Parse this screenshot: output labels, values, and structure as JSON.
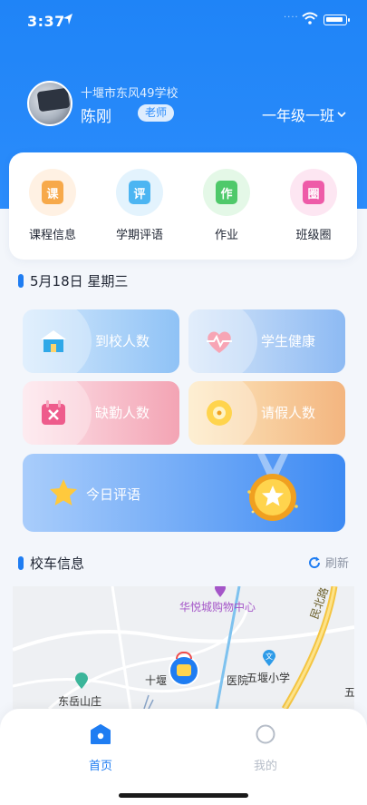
{
  "status_bar": {
    "time": "3:37"
  },
  "profile": {
    "school": "十堰市东风49学校",
    "name": "陈刚",
    "role_badge": "老师",
    "class_selector": "一年级一班"
  },
  "menu": [
    {
      "label": "课程信息",
      "glyph": "课",
      "icon": "course-info-icon",
      "bg": "#fff1e3",
      "fg": "#f7a94a"
    },
    {
      "label": "学期评语",
      "glyph": "评",
      "icon": "term-comment-icon",
      "bg": "#e3f3fd",
      "fg": "#4cb5f2"
    },
    {
      "label": "作业",
      "glyph": "作",
      "icon": "homework-icon",
      "bg": "#e4f8e7",
      "fg": "#4fc96a"
    },
    {
      "label": "班级圈",
      "glyph": "圈",
      "icon": "class-circle-icon",
      "bg": "#fde6f2",
      "fg": "#ee5ba8"
    }
  ],
  "date_section": {
    "title": "5月18日  星期三"
  },
  "stats": [
    {
      "label": "到校人数",
      "icon": "school-arrival-icon",
      "from": "#bfe0fb",
      "to": "#8ec1f6"
    },
    {
      "label": "学生健康",
      "icon": "heart-health-icon",
      "from": "#c7def7",
      "to": "#8dbaf3"
    },
    {
      "label": "缺勤人数",
      "icon": "absence-calendar-icon",
      "from": "#fbdde6",
      "to": "#f3a4b4"
    },
    {
      "label": "请假人数",
      "icon": "leave-clock-icon",
      "from": "#fbe2b6",
      "to": "#f3b57f"
    }
  ],
  "evaluation": {
    "label": "今日评语",
    "star_icon": "star-icon",
    "medal_icon": "medal-icon"
  },
  "bus_section": {
    "title": "校车信息",
    "refresh_label": "刷新"
  },
  "map": {
    "labels": {
      "mall": "华悦城购物中心",
      "hospital": "十堰",
      "hospital_tail": "医院",
      "school": "五堰小学",
      "area": "东岳山庄",
      "road": "民北路",
      "edge": "五"
    }
  },
  "tabs": [
    {
      "label": "首页",
      "active": true,
      "color": "#1f7df2"
    },
    {
      "label": "我的",
      "active": false,
      "color": "#b6bdc8"
    }
  ],
  "colors": {
    "primary": "#1f84f7",
    "section_bar": "#1f7df2"
  }
}
